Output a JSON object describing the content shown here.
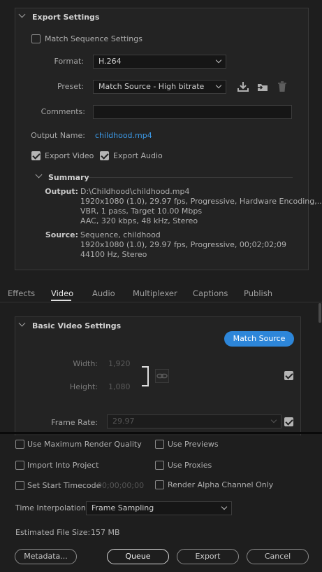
{
  "export_settings": {
    "title": "Export Settings",
    "match_sequence_label": "Match Sequence Settings",
    "format_label": "Format:",
    "format_value": "H.264",
    "preset_label": "Preset:",
    "preset_value": "Match Source - High bitrate",
    "comments_label": "Comments:",
    "comments_value": "",
    "output_name_label": "Output Name:",
    "output_name_value": "childhood.mp4",
    "export_video_label": "Export Video",
    "export_audio_label": "Export Audio"
  },
  "summary": {
    "title": "Summary",
    "output_key": "Output:",
    "output_lines": [
      "D:\\Childhood\\childhood.mp4",
      "1920x1080 (1.0), 29.97 fps, Progressive, Hardware Encoding,...",
      "VBR, 1 pass, Target 10.00 Mbps",
      "AAC, 320 kbps, 48 kHz, Stereo"
    ],
    "source_key": "Source:",
    "source_lines": [
      "Sequence, childhood",
      "1920x1080 (1.0), 29.97 fps, Progressive, 00;02;02;09",
      "44100 Hz, Stereo"
    ]
  },
  "tabs": [
    "Effects",
    "Video",
    "Audio",
    "Multiplexer",
    "Captions",
    "Publish"
  ],
  "active_tab": "Video",
  "basic_video": {
    "title": "Basic Video Settings",
    "match_source_label": "Match Source",
    "width_label": "Width:",
    "width_value": "1,920",
    "height_label": "Height:",
    "height_value": "1,080",
    "frame_rate_label": "Frame Rate:",
    "frame_rate_value": "29.97"
  },
  "bottom": {
    "max_render_quality": "Use Maximum Render Quality",
    "use_previews": "Use Previews",
    "import_into_project": "Import Into Project",
    "use_proxies": "Use Proxies",
    "set_start_timecode": "Set Start Timecode",
    "start_timecode_value": "00;00;00;00",
    "render_alpha": "Render Alpha Channel Only",
    "time_interp_label": "Time Interpolation:",
    "time_interp_value": "Frame Sampling",
    "est_size_label": "Estimated File Size:",
    "est_size_value": "157 MB",
    "metadata_btn": "Metadata...",
    "queue_btn": "Queue",
    "export_btn": "Export",
    "cancel_btn": "Cancel"
  },
  "icons": {
    "save_preset": "download-icon",
    "import_preset": "import-folder-icon",
    "delete_preset": "trash-icon",
    "link": "chain-link-icon"
  },
  "colors": {
    "accent": "#2d86d9",
    "link": "#3c9ae8",
    "background": "#1e1e1e"
  }
}
